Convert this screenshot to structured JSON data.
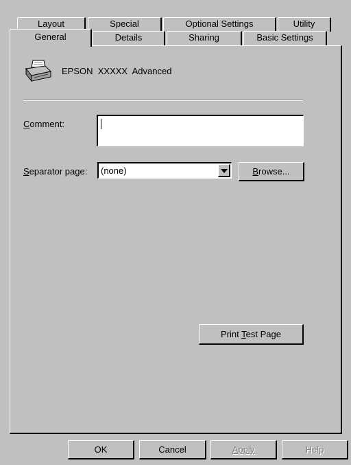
{
  "tabs": {
    "back_row": [
      {
        "label": "Layout"
      },
      {
        "label": "Special"
      },
      {
        "label": "Optional Settings"
      },
      {
        "label": "Utility"
      }
    ],
    "front_row": [
      {
        "label": "General",
        "selected": true
      },
      {
        "label": "Details"
      },
      {
        "label": "Sharing"
      },
      {
        "label": "Basic Settings"
      }
    ]
  },
  "printer": {
    "icon": "printer-icon",
    "name": "EPSON  XXXXX  Advanced"
  },
  "comment": {
    "label": "Comment:",
    "value": ""
  },
  "separator": {
    "label": "Separator page:",
    "selected": "(none)",
    "browse_label": "Browse..."
  },
  "print_test_label": "Print Test Page",
  "footer": {
    "ok_label": "OK",
    "cancel_label": "Cancel",
    "apply_label": "Apply",
    "help_label": "Help"
  },
  "colors": {
    "face": "#c0c0c0",
    "highlight": "#ffffff",
    "shadow": "#000000",
    "disabled_text": "#808080"
  }
}
